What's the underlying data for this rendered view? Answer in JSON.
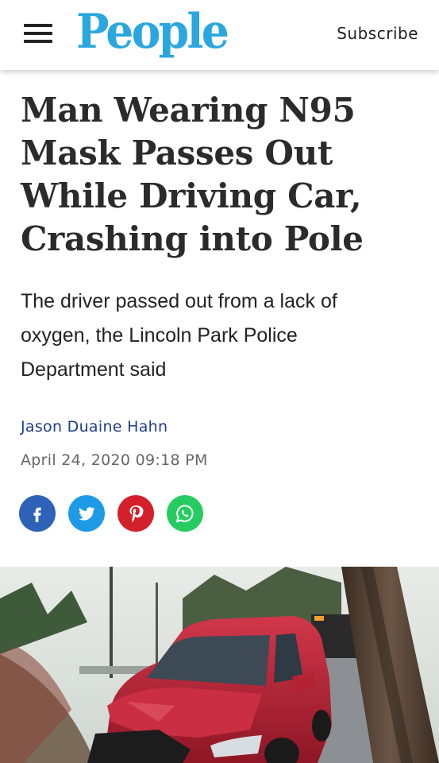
{
  "header": {
    "menu_icon": "hamburger-menu-icon",
    "logo_text": "People",
    "subscribe_label": "Subscribe",
    "brand_color": "#2aa7de"
  },
  "article": {
    "headline": "Man Wearing N95 Mask Passes Out While Driving Car, Crashing into Pole",
    "dek": "The driver passed out from a lack of oxygen, the Lincoln Park Police Department said",
    "author": "Jason Duaine Hahn",
    "date": "April 24, 2020 09:18 PM"
  },
  "share": [
    {
      "network": "facebook",
      "icon": "facebook-icon",
      "color": "#2d62b8"
    },
    {
      "network": "twitter",
      "icon": "twitter-icon",
      "color": "#1d9be6"
    },
    {
      "network": "pinterest",
      "icon": "pinterest-icon",
      "color": "#d3202a"
    },
    {
      "network": "whatsapp",
      "icon": "whatsapp-icon",
      "color": "#26cc62"
    }
  ],
  "hero_image": {
    "subject": "red-crashed-suv-photo"
  }
}
